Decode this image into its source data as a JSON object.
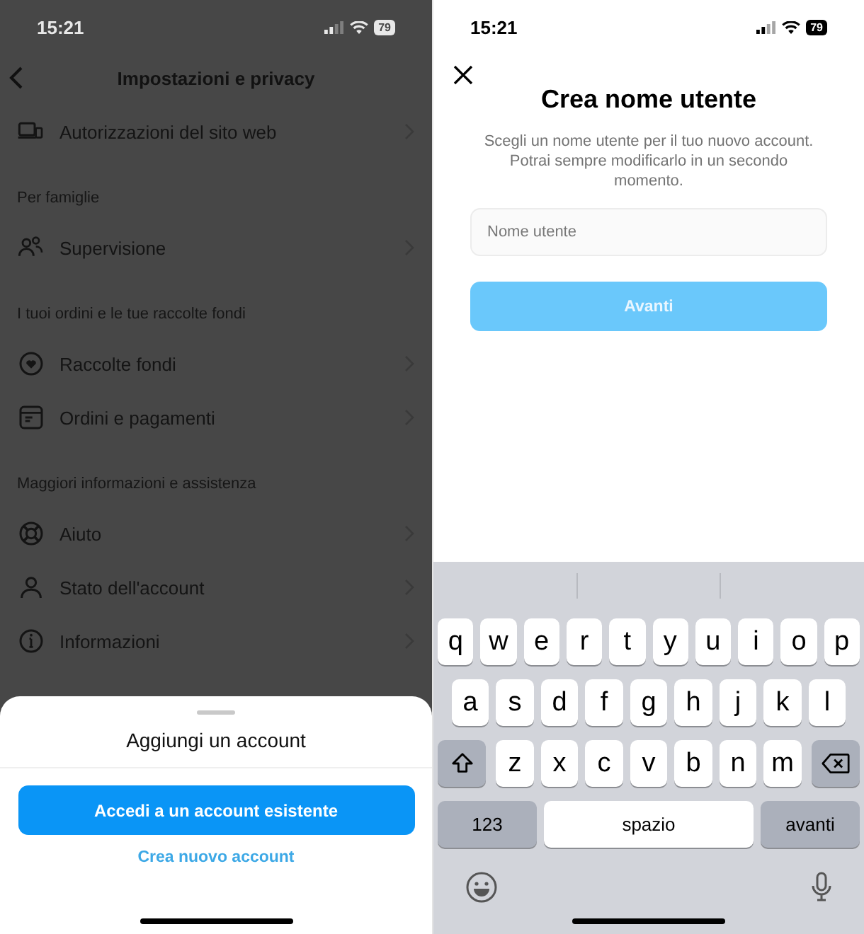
{
  "settings_screen": {
    "status_bar": {
      "time": "15:21",
      "battery": "79"
    },
    "title": "Impostazioni e privacy",
    "items": [
      {
        "kind": "row",
        "label": "Autorizzazioni del sito web"
      },
      {
        "kind": "section",
        "label": "Per famiglie"
      },
      {
        "kind": "row",
        "label": "Supervisione"
      },
      {
        "kind": "section",
        "label": "I tuoi ordini e le tue raccolte fondi"
      },
      {
        "kind": "row",
        "label": "Raccolte fondi"
      },
      {
        "kind": "row",
        "label": "Ordini e pagamenti"
      },
      {
        "kind": "section",
        "label": "Maggiori informazioni e assistenza"
      },
      {
        "kind": "row",
        "label": "Aiuto"
      },
      {
        "kind": "row",
        "label": "Stato dell'account"
      },
      {
        "kind": "row",
        "label": "Informazioni"
      }
    ]
  },
  "add_account_sheet": {
    "title": "Aggiungi un account",
    "primary_button": "Accedi a un account esistente",
    "link": "Crea nuovo account"
  },
  "username_screen": {
    "status_bar": {
      "time": "15:21",
      "battery": "79"
    },
    "title": "Crea nome utente",
    "description": "Scegli un nome utente per il tuo nuovo account. Potrai sempre modificarlo in un secondo momento.",
    "field": {
      "placeholder": "Nome utente"
    },
    "button": {
      "label": "Avanti",
      "disabled": true
    }
  },
  "keyboard": {
    "rows": [
      {
        "keys": [
          {
            "kind": "letter",
            "label": "q"
          },
          {
            "kind": "letter",
            "label": "w"
          },
          {
            "kind": "letter",
            "label": "e"
          },
          {
            "kind": "letter",
            "label": "r"
          },
          {
            "kind": "letter",
            "label": "t"
          },
          {
            "kind": "letter",
            "label": "y"
          },
          {
            "kind": "letter",
            "label": "u"
          },
          {
            "kind": "letter",
            "label": "i"
          },
          {
            "kind": "letter",
            "label": "o"
          },
          {
            "kind": "letter",
            "label": "p"
          }
        ]
      },
      {
        "keys": [
          {
            "kind": "letter",
            "label": "a"
          },
          {
            "kind": "letter",
            "label": "s"
          },
          {
            "kind": "letter",
            "label": "d"
          },
          {
            "kind": "letter",
            "label": "f"
          },
          {
            "kind": "letter",
            "label": "g"
          },
          {
            "kind": "letter",
            "label": "h"
          },
          {
            "kind": "letter",
            "label": "j"
          },
          {
            "kind": "letter",
            "label": "k"
          },
          {
            "kind": "letter",
            "label": "l"
          }
        ]
      },
      {
        "keys": [
          {
            "kind": "shift"
          },
          {
            "kind": "letter",
            "label": "z"
          },
          {
            "kind": "letter",
            "label": "x"
          },
          {
            "kind": "letter",
            "label": "c"
          },
          {
            "kind": "letter",
            "label": "v"
          },
          {
            "kind": "letter",
            "label": "b"
          },
          {
            "kind": "letter",
            "label": "n"
          },
          {
            "kind": "letter",
            "label": "m"
          },
          {
            "kind": "delete"
          }
        ]
      }
    ],
    "bottom_keys": {
      "numbers": "123",
      "space": "spazio",
      "return": "avanti"
    }
  }
}
